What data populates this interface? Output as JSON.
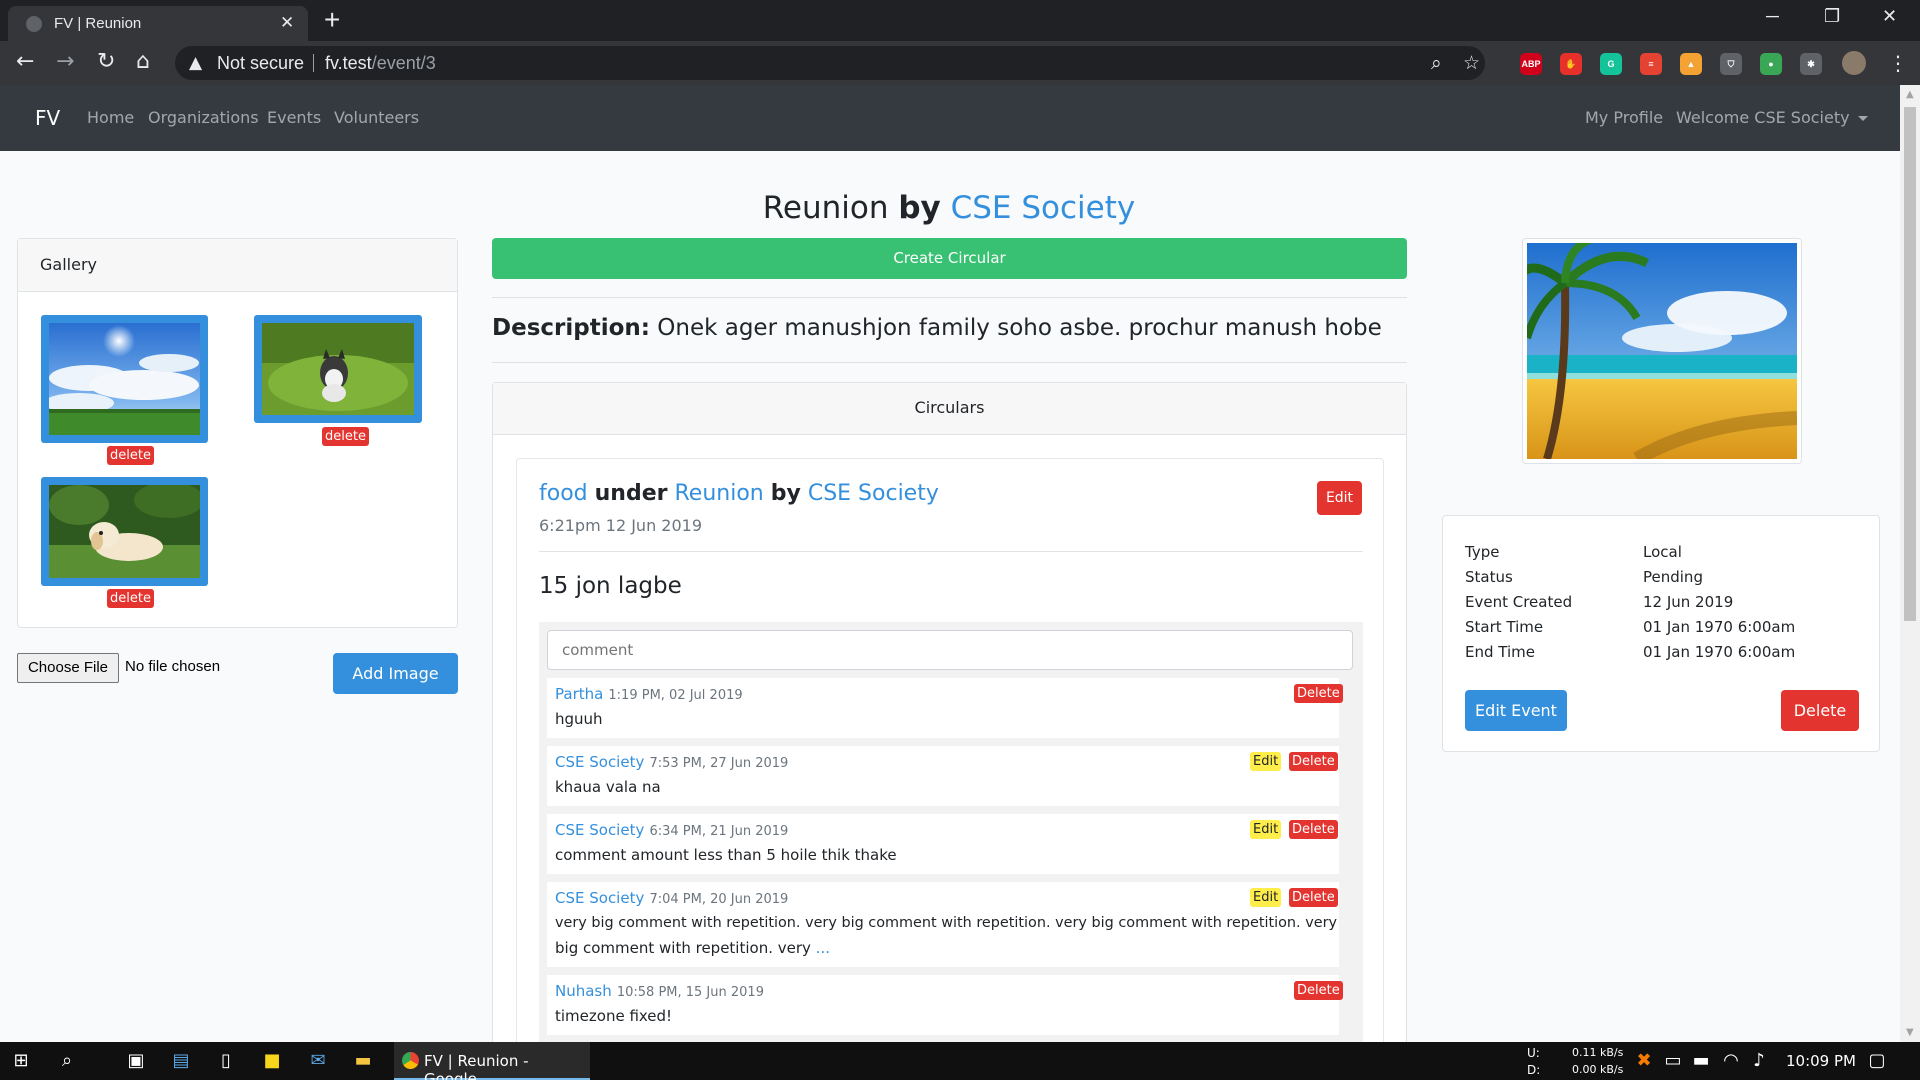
{
  "browser": {
    "tab_title": "FV | Reunion",
    "tab_close": "✕",
    "new_tab": "+",
    "window_controls": {
      "minimize": "─",
      "restore": "❐",
      "close": "✕"
    },
    "nav": {
      "back": "←",
      "forward": "→",
      "reload": "↻",
      "home": "⌂"
    },
    "security_label": "Not secure",
    "url_host": "fv.test",
    "url_path": "/event/3",
    "extensions": [
      {
        "name": "adblock-plus-icon",
        "label": "ABP",
        "color": "#d0021b"
      },
      {
        "name": "adblock-icon",
        "label": "✋",
        "color": "#e8302a"
      },
      {
        "name": "grammarly-icon",
        "label": "G",
        "color": "#15c39a"
      },
      {
        "name": "todoist-icon",
        "label": "≡",
        "color": "#e44332"
      },
      {
        "name": "lighthouse-icon",
        "label": "▲",
        "color": "#f4a234"
      },
      {
        "name": "brave-shield-icon",
        "label": "⛉",
        "color": "#5f6368"
      },
      {
        "name": "color-picker-icon",
        "label": "●",
        "color": "#3aa757"
      },
      {
        "name": "extensions-puzzle-icon",
        "label": "✱",
        "color": "#5f6368"
      }
    ]
  },
  "site_nav": {
    "brand": "FV",
    "links": [
      "Home",
      "Organizations",
      "Events",
      "Volunteers"
    ],
    "my_profile": "My Profile",
    "welcome": "Welcome CSE Society"
  },
  "gallery": {
    "header": "Gallery",
    "delete_label": "delete",
    "images": [
      {
        "name": "sky-clouds-image"
      },
      {
        "name": "husky-puppy-image"
      },
      {
        "name": "golden-puppy-image"
      }
    ],
    "choose_file": "Choose File",
    "no_file": "No file chosen",
    "add_image": "Add Image"
  },
  "event": {
    "title": "Reunion",
    "by": "by",
    "organization": "CSE Society",
    "create_circular": "Create Circular",
    "description_label": "Description:",
    "description": "Onek ager manushjon family soho asbe. prochur manush hobe"
  },
  "circulars": {
    "header": "Circulars",
    "item": {
      "title": "food",
      "under": "under",
      "event": "Reunion",
      "by": "by",
      "organization": "CSE Society",
      "edit": "Edit",
      "timestamp": "6:21pm 12 Jun 2019",
      "body": "15 jon lagbe",
      "comment_placeholder": "comment"
    },
    "comments": [
      {
        "author": "Partha",
        "time": "1:19 PM, 02 Jul 2019",
        "text": "hguuh",
        "editable": false
      },
      {
        "author": "CSE Society",
        "time": "7:53 PM, 27 Jun 2019",
        "text": "khaua vala na",
        "editable": true
      },
      {
        "author": "CSE Society",
        "time": "6:34 PM, 21 Jun 2019",
        "text": "comment amount less than 5 hoile thik thake",
        "editable": true
      },
      {
        "author": "CSE Society",
        "time": "7:04 PM, 20 Jun 2019",
        "text": "very big comment with repetition. very big comment with repetition. very big comment with repetition. very",
        "text2": "big comment with repetition. very",
        "more": "...",
        "editable": true
      },
      {
        "author": "Nuhash",
        "time": "10:58 PM, 15 Jun 2019",
        "text": "timezone fixed!",
        "editable": false
      }
    ],
    "edit_label": "Edit",
    "delete_label": "Delete"
  },
  "event_info": {
    "rows": [
      {
        "label": "Type",
        "value": "Local"
      },
      {
        "label": "Status",
        "value": "Pending"
      },
      {
        "label": "Event Created",
        "value": "12 Jun 2019"
      },
      {
        "label": "Start Time",
        "value": "01 Jan 1970 6:00am"
      },
      {
        "label": "End Time",
        "value": "01 Jan 1970 6:00am"
      }
    ],
    "edit_event": "Edit Event",
    "delete": "Delete"
  },
  "taskbar": {
    "app_title": "FV | Reunion - Google...",
    "net_up_label": "U:",
    "net_down_label": "D:",
    "net_up": "0.11 kB/s",
    "net_down": "0.00 kB/s",
    "clock": "10:09 PM"
  },
  "colors": {
    "primary": "#3490dc",
    "success": "#38c172",
    "danger": "#e3342f",
    "warning": "#ffed4a",
    "navbar": "#343a40"
  }
}
